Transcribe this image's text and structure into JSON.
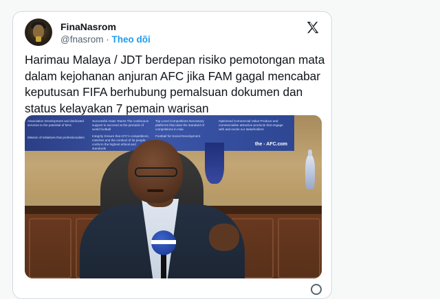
{
  "author": {
    "name": "FinaNasrom",
    "handle": "@fnasrom",
    "separator": "·",
    "follow_label": "Theo dõi"
  },
  "tweet": {
    "text": "Harimau Malaya / JDT berdepan risiko pemotongan mata dalam kejohanan anjuran AFC jika FAM gagal mencabar keputusan FIFA berhubung pemalsuan dokumen dan status kelayakan 7 pemain warisan"
  },
  "media": {
    "banner_columns": [
      "Association Development and dedicated services to the potential of MAs",
      "Successful Asian Teams The continuous support to succeed at the pinnacle of world football",
      "Top Level Competitions Necessary platforms that raise the standard of competitions in Asia",
      "Optimised Commercial Value Produce and commercialise attractive products that engage with and excite our stakeholders"
    ],
    "banner_row2": [
      "Mission of initiatives that professionalism",
      "Integrity Ensure that AFC's competitions, matches and the conduct of its people conform the highest ethical and standards",
      "Football for Social Development"
    ],
    "site_label": "the - AFC.com"
  },
  "icons": {
    "brand": "x-logo-icon",
    "avatar": "user-avatar",
    "footer": "info-icon"
  }
}
